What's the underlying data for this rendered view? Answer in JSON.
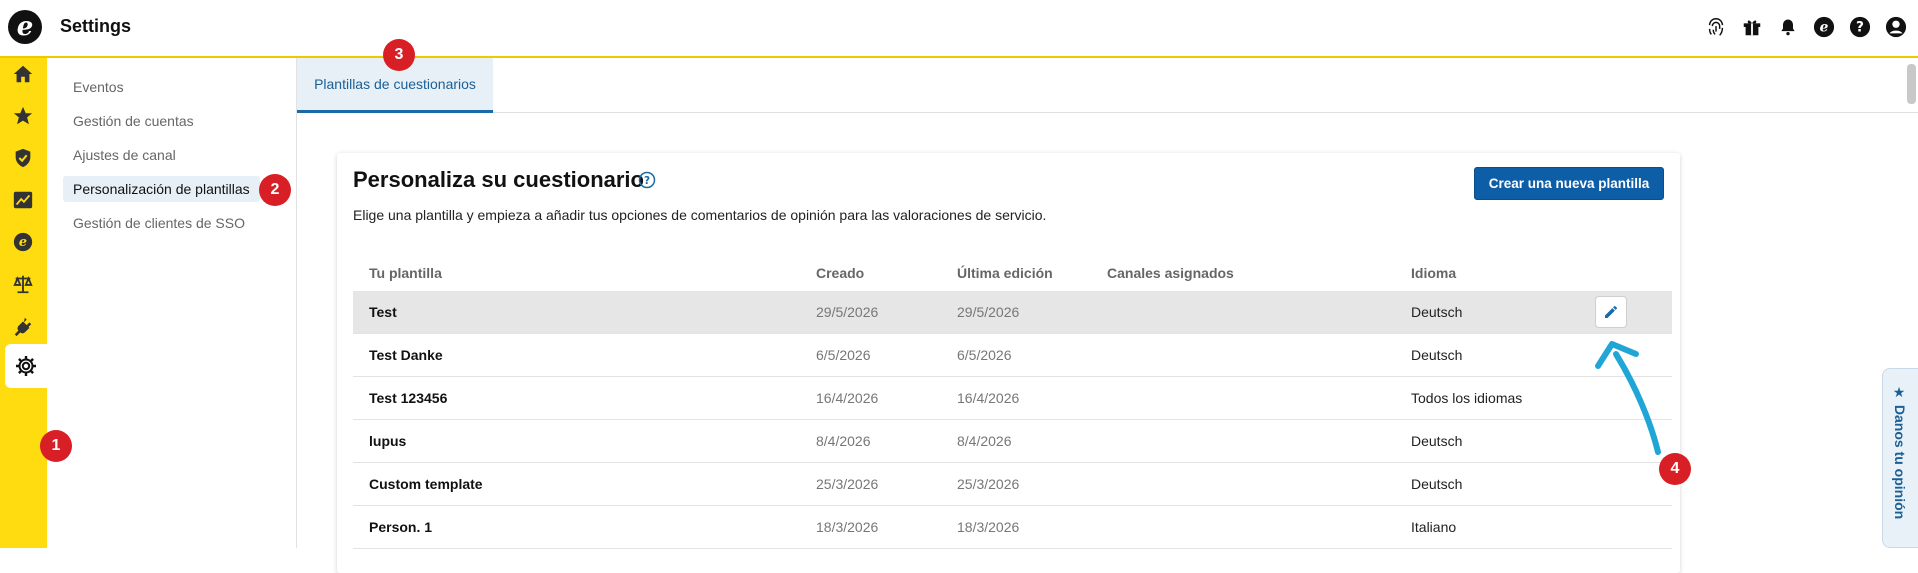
{
  "header": {
    "title": "Settings",
    "logo_letter": "e"
  },
  "top_icons": [
    "fingerprint-icon",
    "gift-icon",
    "bell-icon",
    "trusted-shops-icon",
    "help-icon",
    "account-icon"
  ],
  "rail": {
    "items": [
      "home-icon",
      "star-icon",
      "shield-check-icon",
      "chart-icon",
      "trusted-shops-icon",
      "scales-icon",
      "plug-icon",
      "gear-icon"
    ],
    "active": "gear-icon"
  },
  "subnav": {
    "items": [
      {
        "label": "Eventos"
      },
      {
        "label": "Gestión de cuentas"
      },
      {
        "label": "Ajustes de canal"
      },
      {
        "label": "Personalización de plantillas",
        "active": true
      },
      {
        "label": "Gestión de clientes de SSO"
      }
    ]
  },
  "tabs": [
    {
      "label": "Plantillas de cuestionarios",
      "active": true
    }
  ],
  "badges": {
    "b1": "1",
    "b2": "2",
    "b3": "3",
    "b4": "4"
  },
  "card": {
    "title": "Personaliza su cuestionario",
    "description": "Elige una plantilla y empieza a añadir tus opciones de comentarios de opinión para las valoraciones de servicio.",
    "create_button": "Crear una nueva plantilla"
  },
  "table": {
    "headers": {
      "name": "Tu plantilla",
      "created": "Creado",
      "edited": "Última edición",
      "channels": "Canales asignados",
      "language": "Idioma"
    },
    "rows": [
      {
        "name": "Test",
        "created": "29/5/2026",
        "edited": "29/5/2026",
        "channels": "",
        "language": "Deutsch"
      },
      {
        "name": "Test Danke",
        "created": "6/5/2026",
        "edited": "6/5/2026",
        "channels": "",
        "language": "Deutsch"
      },
      {
        "name": "Test 123456",
        "created": "16/4/2026",
        "edited": "16/4/2026",
        "channels": "",
        "language": "Todos los idiomas"
      },
      {
        "name": "lupus",
        "created": "8/4/2026",
        "edited": "8/4/2026",
        "channels": "",
        "language": "Deutsch"
      },
      {
        "name": "Custom template",
        "created": "25/3/2026",
        "edited": "25/3/2026",
        "channels": "",
        "language": "Deutsch"
      },
      {
        "name": "Person. 1",
        "created": "18/3/2026",
        "edited": "18/3/2026",
        "channels": "",
        "language": "Italiano"
      }
    ]
  },
  "feedback": {
    "label": "★ Danos tu opinión"
  },
  "colors": {
    "brand_yellow": "#ffdc0f",
    "primary_blue": "#0d5ea6",
    "badge_red": "#d91f26",
    "annotation_arrow": "#1fa6d6"
  }
}
